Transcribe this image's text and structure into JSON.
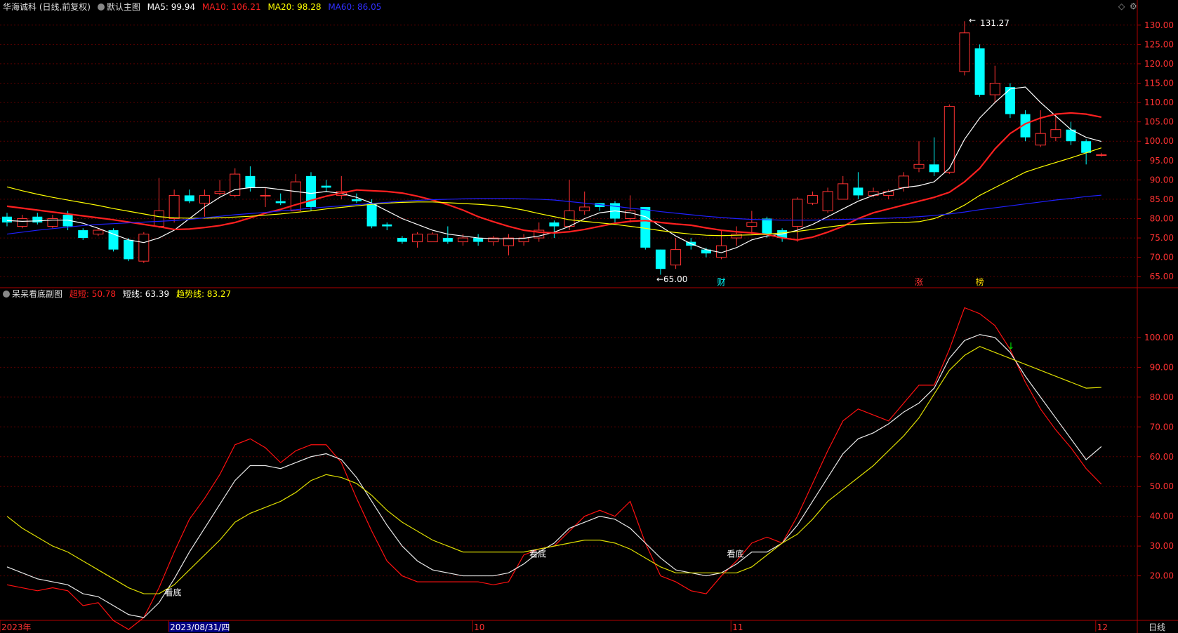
{
  "header": {
    "stock_name": "华海诚科 (日线,前复权)",
    "main_title": "默认主图",
    "ma5": "MA5: 99.94",
    "ma10": "MA10: 106.21",
    "ma20": "MA20: 98.28",
    "ma60": "MA60: 86.05"
  },
  "sub_header": {
    "title": "呆呆看底副图",
    "super_short": "超短: 50.78",
    "short": "短线: 63.39",
    "trend": "趋势线: 83.27"
  },
  "colors": {
    "up": "#ff3232",
    "down": "#00ffff",
    "ma5": "#ffffff",
    "ma10": "#ff2020",
    "ma20": "#ffff00",
    "ma60": "#2020ff",
    "axis": "#b00000"
  },
  "tools": {
    "diamond_icon": "◇",
    "settings_icon": "⚙"
  },
  "chart_data": [
    {
      "type": "candlestick",
      "ylim": [
        62.5,
        132.5
      ],
      "yticks": [
        "130.00",
        "125.00",
        "120.00",
        "115.00",
        "110.00",
        "105.00",
        "100.00",
        "95.00",
        "90.00",
        "85.00",
        "80.00",
        "75.00",
        "70.00",
        "65.00"
      ],
      "candles": [
        [
          80.5,
          79,
          81.5,
          78
        ],
        [
          78,
          80,
          81,
          77.5
        ],
        [
          80.5,
          79,
          81.5,
          78.5
        ],
        [
          78,
          80,
          81,
          77.5
        ],
        [
          81,
          78,
          82,
          77
        ],
        [
          77,
          75,
          77.5,
          74.5
        ],
        [
          76,
          77,
          77.5,
          75.5
        ],
        [
          77,
          72,
          77.5,
          71.5
        ],
        [
          74.5,
          69.5,
          75,
          69
        ],
        [
          69,
          76,
          76.5,
          68.5
        ],
        [
          78,
          82,
          90.5,
          77.5
        ],
        [
          80,
          86,
          87.5,
          79
        ],
        [
          86,
          84.5,
          87.5,
          84
        ],
        [
          84,
          86,
          87.5,
          80.5
        ],
        [
          86.5,
          87,
          90,
          86
        ],
        [
          86,
          91.5,
          93,
          85.5
        ],
        [
          91,
          88,
          93.5,
          87
        ],
        [
          86,
          86,
          88,
          83
        ],
        [
          84.5,
          84,
          86.5,
          83.5
        ],
        [
          82,
          89.5,
          91.5,
          82
        ],
        [
          91,
          83,
          92,
          82
        ],
        [
          88.5,
          88,
          90,
          87
        ],
        [
          86,
          87,
          91,
          85
        ],
        [
          85,
          84.5,
          86.5,
          84
        ],
        [
          84,
          78,
          85,
          77.5
        ],
        [
          78.5,
          78,
          79,
          77
        ],
        [
          75,
          74,
          75.5,
          73.5
        ],
        [
          74,
          76,
          76.5,
          72.5
        ],
        [
          74,
          76,
          76.5,
          75
        ],
        [
          75,
          74,
          78,
          73.5
        ],
        [
          74,
          75,
          76,
          73
        ],
        [
          75,
          74,
          76,
          73
        ],
        [
          74,
          75,
          75.5,
          73
        ],
        [
          73,
          75,
          76,
          70.5
        ],
        [
          74,
          75,
          76,
          73
        ],
        [
          75,
          77,
          79,
          74
        ],
        [
          79,
          78,
          79.5,
          75
        ],
        [
          78,
          82,
          90,
          77
        ],
        [
          82,
          83,
          87,
          81
        ],
        [
          84,
          83,
          84,
          82
        ],
        [
          84,
          80,
          84.5,
          79
        ],
        [
          80,
          82,
          86,
          79
        ],
        [
          83,
          72.5,
          83,
          72
        ],
        [
          72,
          67,
          72,
          65.5
        ],
        [
          68,
          72,
          75,
          67
        ],
        [
          74,
          73,
          75,
          72
        ],
        [
          72,
          71,
          72.5,
          70
        ],
        [
          70,
          73,
          77,
          69.5
        ],
        [
          75,
          76,
          78,
          73
        ],
        [
          78,
          79,
          82,
          76
        ],
        [
          80,
          76,
          80.5,
          75
        ],
        [
          77,
          75,
          77.5,
          74
        ],
        [
          78,
          85,
          85.5,
          74
        ],
        [
          84,
          86,
          87,
          83.5
        ],
        [
          82,
          87,
          88,
          81.5
        ],
        [
          85,
          89,
          91,
          85
        ],
        [
          88,
          86,
          92,
          85
        ],
        [
          86,
          87,
          88,
          85.5
        ],
        [
          86,
          87,
          87.5,
          85
        ],
        [
          88,
          91,
          92,
          87
        ],
        [
          93,
          94,
          100,
          92
        ],
        [
          94,
          92,
          101,
          91
        ],
        [
          92,
          109,
          109.5,
          91.5
        ],
        [
          118,
          128,
          131,
          117
        ],
        [
          124,
          112,
          125,
          111.5
        ],
        [
          112,
          115,
          119.5,
          110
        ],
        [
          114,
          107,
          115,
          106
        ],
        [
          107,
          101,
          108,
          100
        ],
        [
          99,
          102,
          108,
          98.5
        ],
        [
          101,
          103,
          107,
          100
        ],
        [
          103,
          100,
          105,
          99
        ],
        [
          100,
          97,
          100.5,
          94
        ],
        [
          96.5,
          96.5,
          97,
          96
        ]
      ],
      "series": [
        {
          "name": "MA5",
          "values": [
            79.5,
            79.3,
            79.4,
            79.6,
            79.6,
            78.8,
            77.5,
            76.0,
            74.5,
            73.8,
            75.0,
            77.0,
            80.0,
            83.0,
            85.5,
            87.5,
            88.0,
            88.0,
            87.5,
            87.0,
            86.5,
            87.0,
            86.5,
            85.5,
            84.0,
            82.0,
            80.0,
            78.5,
            77.0,
            76.0,
            75.5,
            75.0,
            74.8,
            74.8,
            74.9,
            75.5,
            76.5,
            78.0,
            80.0,
            81.5,
            82.0,
            81.5,
            80.5,
            78.0,
            75.5,
            73.5,
            72.0,
            71.2,
            72.5,
            74.5,
            75.5,
            76.0,
            77.0,
            78.5,
            80.5,
            82.5,
            84.5,
            86.0,
            87.0,
            88.0,
            88.5,
            89.5,
            93.0,
            100.5,
            106.0,
            110.0,
            113.5,
            114.0,
            110.0,
            106.5,
            103.0,
            101.0,
            99.94
          ]
        },
        {
          "name": "MA10",
          "values": [
            83.2,
            82.7,
            82.2,
            81.7,
            81.2,
            80.7,
            80.2,
            79.7,
            79.1,
            78.5,
            77.9,
            77.2,
            77.3,
            77.7,
            78.2,
            79.0,
            80.2,
            81.4,
            82.4,
            83.6,
            84.7,
            85.8,
            86.6,
            87.4,
            87.2,
            87.0,
            86.6,
            85.8,
            84.8,
            83.6,
            82.2,
            80.5,
            79.2,
            78.0,
            77.0,
            76.5,
            76.3,
            76.6,
            77.2,
            78.0,
            78.8,
            79.3,
            79.5,
            79.0,
            78.6,
            78.3,
            77.6,
            77.0,
            76.6,
            76.3,
            75.9,
            75.0,
            74.5,
            75.2,
            76.5,
            78.0,
            80.0,
            81.5,
            82.5,
            83.5,
            84.5,
            85.5,
            86.8,
            89.5,
            93.0,
            98.0,
            102.0,
            104.5,
            106.0,
            107.0,
            107.3,
            107.0,
            106.21
          ]
        },
        {
          "name": "MA20",
          "values": [
            88.2,
            87.2,
            86.3,
            85.5,
            84.8,
            84.1,
            83.4,
            82.6,
            81.9,
            81.2,
            80.5,
            80.2,
            80.1,
            80.1,
            80.2,
            80.4,
            80.6,
            80.9,
            81.2,
            81.6,
            82.0,
            82.5,
            82.9,
            83.3,
            83.7,
            84.0,
            84.2,
            84.3,
            84.3,
            84.1,
            83.9,
            83.7,
            83.4,
            82.9,
            82.2,
            81.3,
            80.5,
            79.7,
            79.3,
            78.9,
            78.5,
            78.0,
            77.5,
            76.9,
            76.4,
            76.0,
            75.7,
            75.6,
            75.7,
            75.8,
            76.0,
            76.3,
            76.7,
            77.2,
            77.8,
            78.3,
            78.6,
            78.8,
            78.9,
            79.0,
            79.2,
            80.0,
            81.5,
            83.5,
            86.0,
            88.0,
            90.0,
            92.0,
            93.3,
            94.5,
            95.7,
            97.0,
            98.28
          ]
        },
        {
          "name": "MA60",
          "values": [
            76.0,
            76.5,
            77.0,
            77.4,
            77.8,
            78.2,
            78.5,
            78.7,
            78.9,
            79.1,
            79.3,
            79.5,
            79.8,
            80.2,
            80.6,
            81.0,
            81.3,
            81.6,
            82.0,
            82.3,
            82.7,
            83.0,
            83.3,
            83.6,
            83.9,
            84.2,
            84.5,
            84.7,
            84.9,
            85.0,
            85.1,
            85.2,
            85.2,
            85.2,
            85.1,
            85.0,
            84.8,
            84.4,
            84.0,
            83.6,
            83.2,
            82.7,
            82.3,
            81.8,
            81.4,
            81.0,
            80.6,
            80.3,
            80.0,
            79.8,
            79.7,
            79.6,
            79.6,
            79.6,
            79.7,
            79.8,
            79.9,
            80.0,
            80.1,
            80.3,
            80.5,
            80.8,
            81.2,
            81.7,
            82.3,
            82.8,
            83.3,
            83.8,
            84.3,
            84.8,
            85.2,
            85.7,
            86.05
          ]
        }
      ],
      "annotations": [
        {
          "text": "131.27",
          "index": 63,
          "value": 131.27,
          "arrow": "←"
        },
        {
          "text": "←65.00",
          "index": 43,
          "value": 65.0
        },
        {
          "text": "财",
          "index": 47,
          "color": "#00ffff"
        },
        {
          "text": "涨",
          "index": 60,
          "color": "#ff3232"
        },
        {
          "text": "榜",
          "index": 64,
          "color": "#ffdd00"
        }
      ]
    },
    {
      "type": "line",
      "ylim": [
        6,
        112
      ],
      "yticks": [
        "100.00",
        "90.00",
        "80.00",
        "70.00",
        "60.00",
        "50.00",
        "40.00",
        "30.00",
        "20.00"
      ],
      "series": [
        {
          "name": "超短",
          "values": [
            17,
            16,
            15,
            16,
            15,
            10,
            11,
            5,
            2,
            6,
            16,
            28,
            39,
            46,
            54,
            64,
            66,
            63,
            58,
            62,
            64,
            64,
            58,
            46,
            35,
            25,
            20,
            18,
            18,
            18,
            18,
            18,
            17,
            18,
            27,
            29,
            30,
            35,
            40,
            42,
            40,
            45,
            31,
            20,
            18,
            15,
            14,
            20,
            25,
            31,
            33,
            31,
            40,
            51,
            62,
            72,
            76,
            74,
            72,
            78,
            84,
            84,
            96,
            110,
            108,
            104,
            96,
            85,
            76,
            69,
            63,
            56,
            50.78
          ]
        },
        {
          "name": "短线",
          "values": [
            23,
            21,
            19,
            18,
            17,
            14,
            13,
            10,
            7,
            6,
            11,
            19,
            28,
            36,
            44,
            52,
            57,
            57,
            56,
            58,
            60,
            61,
            59,
            53,
            45,
            37,
            30,
            25,
            22,
            21,
            20,
            20,
            20,
            21,
            24,
            28,
            31,
            36,
            38,
            40,
            39,
            36,
            31,
            26,
            22,
            21,
            20,
            21,
            24,
            28,
            28,
            31,
            37,
            45,
            53,
            61,
            66,
            68,
            71,
            75,
            78,
            83,
            93,
            99,
            101,
            100,
            95,
            87,
            80,
            73,
            66,
            59,
            63.39
          ]
        },
        {
          "name": "趋势线",
          "values": [
            40,
            36,
            33,
            30,
            28,
            25,
            22,
            19,
            16,
            14,
            14,
            17,
            22,
            27,
            32,
            38,
            41,
            43,
            45,
            48,
            52,
            54,
            53,
            51,
            47,
            42,
            38,
            35,
            32,
            30,
            28,
            28,
            28,
            28,
            28,
            29,
            30,
            31,
            32,
            32,
            31,
            29,
            26,
            23,
            21,
            21,
            21,
            21,
            21,
            23,
            27,
            31,
            34,
            39,
            45,
            49,
            53,
            57,
            62,
            67,
            73,
            81,
            89,
            94,
            97,
            95,
            93,
            91,
            89,
            87,
            85,
            83,
            83.27
          ]
        }
      ],
      "annotations": [
        {
          "text": "看底",
          "index": 10,
          "value": 12
        },
        {
          "text": "看底",
          "index": 34,
          "value": 25
        },
        {
          "text": "看底",
          "index": 47,
          "value": 25
        }
      ]
    }
  ],
  "x_axis": {
    "labels": [
      {
        "text": "2023年",
        "index": 0
      },
      {
        "text": "2023/08/31/四",
        "index": 11,
        "highlight": true
      },
      {
        "text": "10",
        "index": 31
      },
      {
        "text": "11",
        "index": 48
      },
      {
        "text": "12",
        "index": 72
      }
    ],
    "period_button": "日线"
  }
}
